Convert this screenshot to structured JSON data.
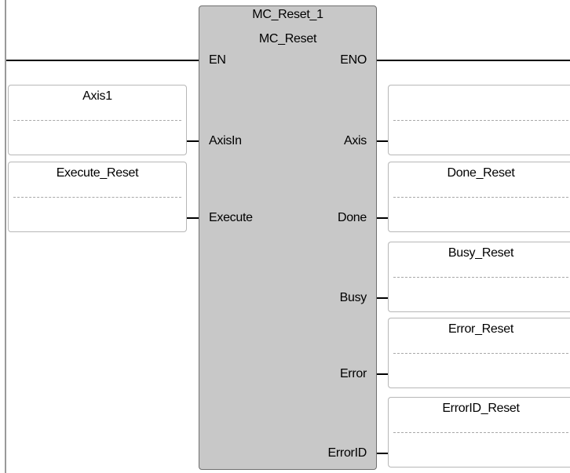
{
  "function_block": {
    "instance_name": "MC_Reset_1",
    "type_name": "MC_Reset",
    "inputs": [
      "EN",
      "AxisIn",
      "Execute"
    ],
    "outputs": [
      "ENO",
      "Axis",
      "Done",
      "Busy",
      "Error",
      "ErrorID"
    ]
  },
  "input_variables": {
    "axis_in": "Axis1",
    "execute": "Execute_Reset"
  },
  "output_variables": {
    "axis": "",
    "done": "Done_Reset",
    "busy": "Busy_Reset",
    "error": "Error_Reset",
    "error_id": "ErrorID_Reset"
  },
  "colors": {
    "block_fill": "#c8c8c8",
    "block_border": "#6f6f6f",
    "wire": "#000000",
    "power_rail": "#9a9a9a"
  }
}
